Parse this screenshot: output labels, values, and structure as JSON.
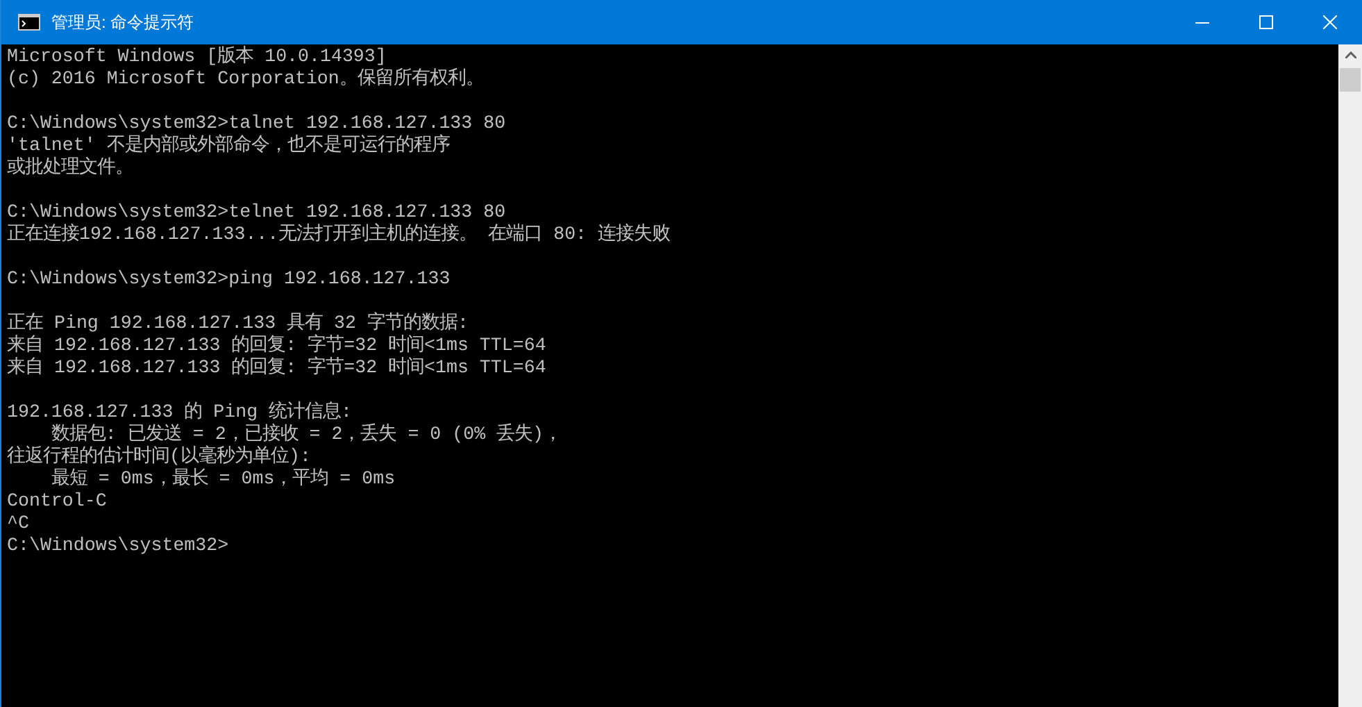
{
  "window": {
    "title": "管理员: 命令提示符"
  },
  "console": {
    "blocks": [
      [
        "Microsoft Windows [版本 10.0.14393]",
        "(c) 2016 Microsoft Corporation。保留所有权利。"
      ],
      [
        "C:\\Windows\\system32>talnet 192.168.127.133 80",
        "'talnet' 不是内部或外部命令，也不是可运行的程序",
        "或批处理文件。"
      ],
      [
        "C:\\Windows\\system32>telnet 192.168.127.133 80",
        "正在连接192.168.127.133...无法打开到主机的连接。 在端口 80: 连接失败"
      ],
      [
        "C:\\Windows\\system32>ping 192.168.127.133"
      ],
      [
        "正在 Ping 192.168.127.133 具有 32 字节的数据:",
        "来自 192.168.127.133 的回复: 字节=32 时间<1ms TTL=64",
        "来自 192.168.127.133 的回复: 字节=32 时间<1ms TTL=64"
      ],
      [
        "192.168.127.133 的 Ping 统计信息:",
        "    数据包: 已发送 = 2，已接收 = 2，丢失 = 0 (0% 丢失)，",
        "往返行程的估计时间(以毫秒为单位):",
        "    最短 = 0ms，最长 = 0ms，平均 = 0ms",
        "Control-C",
        "^C",
        "C:\\Windows\\system32>"
      ]
    ]
  }
}
